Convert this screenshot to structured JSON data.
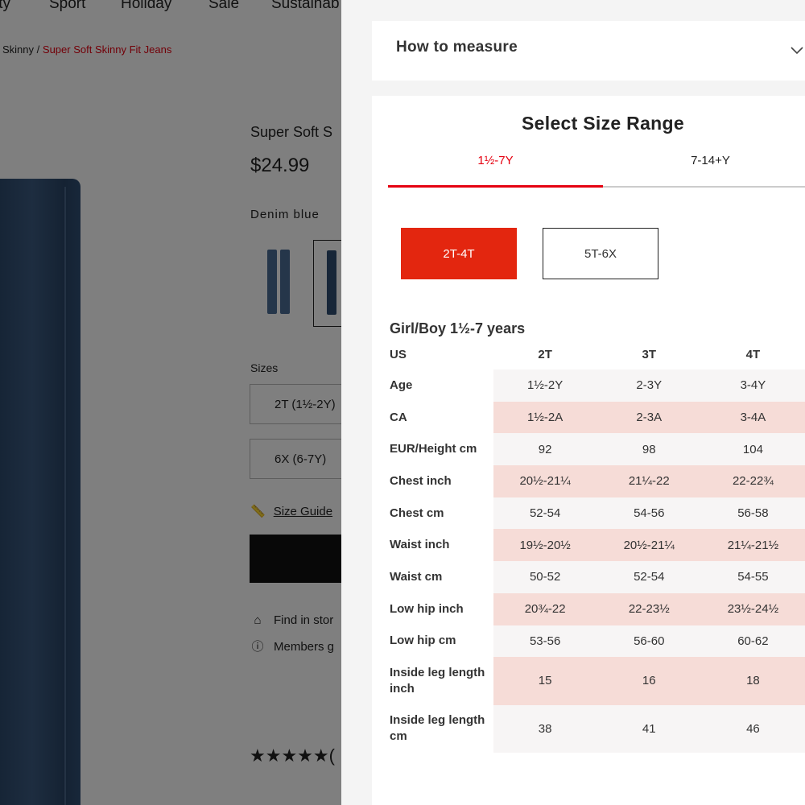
{
  "background_page": {
    "top_nav": [
      "ity",
      "Sport",
      "Holiday",
      "Sale",
      "Sustainab"
    ],
    "breadcrumb": {
      "prev": "Skinny",
      "separator": "/",
      "current": "Super Soft Skinny Fit Jeans"
    },
    "product_title": "Super Soft S",
    "price": "$24.99",
    "color_name": "Denim blue",
    "sizes_label": "Sizes",
    "size_options": [
      "2T (1½-2Y)",
      "6X (6-7Y)"
    ],
    "size_guide": "Size Guide",
    "find_in_store": "Find in stor",
    "members_text": "Members g",
    "stars": "★★★★★",
    "review_count": "(",
    "colors": {
      "jeans": "#2f4d71",
      "overlay": "rgba(0,0,0,0.5)"
    }
  },
  "drawer": {
    "how_to_measure": "How to measure",
    "chevron_icon": "chevron-down-icon",
    "heading": "Select Size Range",
    "range_tabs": [
      {
        "label": "1½-7Y",
        "active": true
      },
      {
        "label": "7-14+Y",
        "active": false
      }
    ],
    "sub_ranges": [
      {
        "label": "2T-4T",
        "active": true
      },
      {
        "label": "5T-6X",
        "active": false
      }
    ],
    "table_title": "Girl/Boy 1½-7 years",
    "table": {
      "header": [
        "US",
        "2T",
        "3T",
        "4T"
      ],
      "rows": [
        {
          "label": "Age",
          "values": [
            "1½-2Y",
            "2-3Y",
            "3-4Y"
          ]
        },
        {
          "label": "CA",
          "values": [
            "1½-2A",
            "2-3A",
            "3-4A"
          ]
        },
        {
          "label": "EUR/Height cm",
          "values": [
            "92",
            "98",
            "104"
          ]
        },
        {
          "label": "Chest inch",
          "values": [
            "20½-21¼",
            "21¼-22",
            "22-22¾"
          ]
        },
        {
          "label": "Chest cm",
          "values": [
            "52-54",
            "54-56",
            "56-58"
          ]
        },
        {
          "label": "Waist inch",
          "values": [
            "19½-20½",
            "20½-21¼",
            "21¼-21½"
          ]
        },
        {
          "label": "Waist cm",
          "values": [
            "50-52",
            "52-54",
            "54-55"
          ]
        },
        {
          "label": "Low hip inch",
          "values": [
            "20¾-22",
            "22-23½",
            "23½-24½"
          ]
        },
        {
          "label": "Low hip cm",
          "values": [
            "53-56",
            "56-60",
            "60-62"
          ]
        },
        {
          "label": "Inside leg length inch",
          "values": [
            "15",
            "16",
            "18"
          ]
        },
        {
          "label": "Inside leg length cm",
          "values": [
            "38",
            "41",
            "46"
          ]
        }
      ]
    },
    "colors": {
      "accent": "#e50010",
      "active_button": "#e3260f",
      "stripe": "#f6dcd7"
    }
  }
}
